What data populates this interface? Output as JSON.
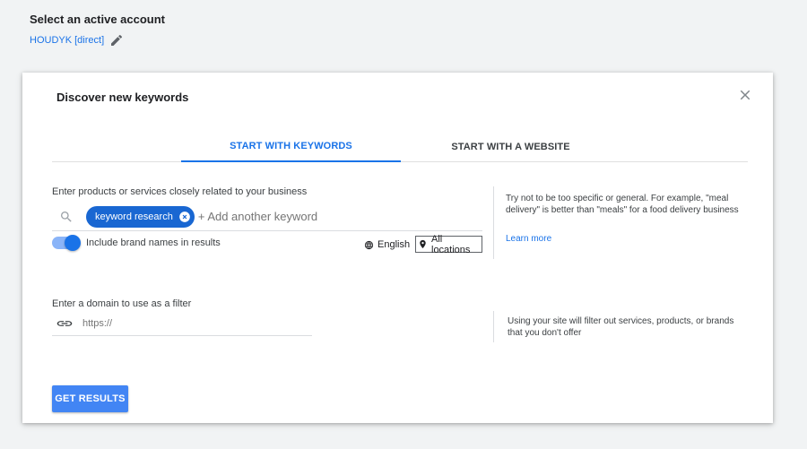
{
  "account": {
    "title": "Select an active account",
    "name": "HOUDYK [direct]",
    "edit_icon": "pencil-icon"
  },
  "dialog": {
    "title": "Discover new keywords",
    "close_icon": "close-icon",
    "tabs": [
      {
        "label": "START WITH KEYWORDS",
        "active": true
      },
      {
        "label": "START WITH A WEBSITE",
        "active": false
      }
    ],
    "keywords": {
      "label": "Enter products or services closely related to your business",
      "search_icon": "search-icon",
      "chips": [
        "keyword research"
      ],
      "placeholder": "+ Add another keyword",
      "brand_toggle": {
        "label": "Include brand names in results",
        "on": true
      },
      "language": {
        "icon": "globe-icon",
        "label": "English"
      },
      "location": {
        "icon": "location-pin-icon",
        "label": "All locations"
      },
      "tip": "Try not to be too specific or general. For example, \"meal delivery\" is better than \"meals\" for a food delivery business",
      "learn_more": "Learn more"
    },
    "domain": {
      "label": "Enter a domain to use as a filter",
      "icon": "link-icon",
      "placeholder": "https://",
      "tip": "Using your site will filter out services, products, or brands that you don't offer"
    },
    "submit_label": "GET RESULTS"
  },
  "colors": {
    "accent": "#1a73e8",
    "chip": "#1967d2",
    "button": "#4285f4",
    "background": "#f1f3f4"
  }
}
